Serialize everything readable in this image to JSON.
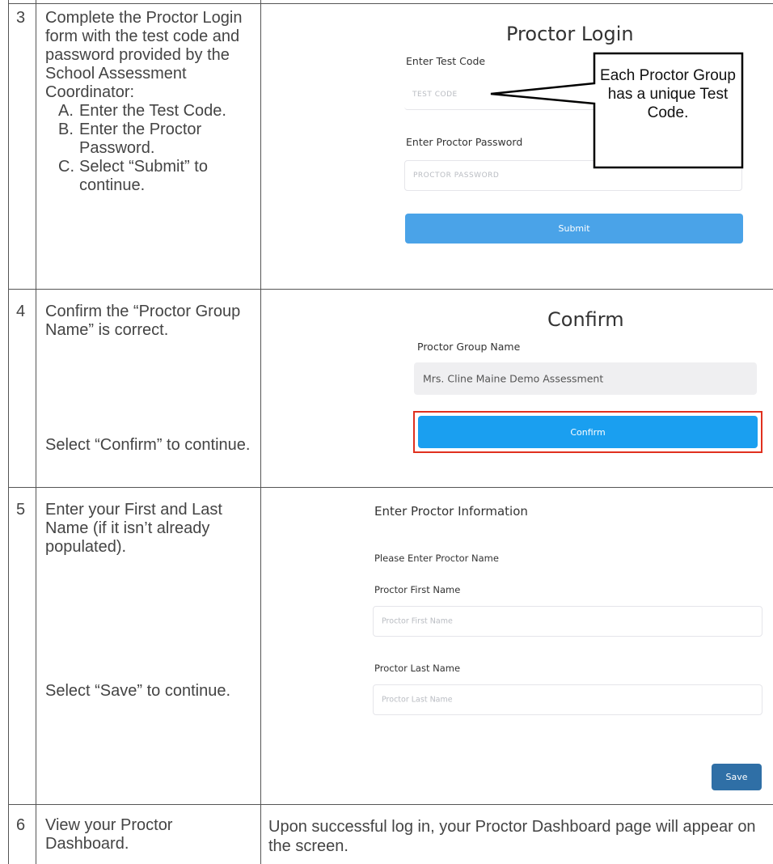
{
  "rows": [
    {
      "number": "3",
      "instruction": "Complete the Proctor Login form with the test code and password provided by the School Assessment Coordinator:",
      "substeps": [
        {
          "letter": "A.",
          "text": "Enter the Test Code."
        },
        {
          "letter": "B.",
          "text": "Enter the Proctor Password."
        },
        {
          "letter": "C.",
          "text": "Select “Submit” to continue."
        }
      ]
    },
    {
      "number": "4",
      "instruction": "Confirm the “Proctor Group Name” is correct.",
      "followup": "Select “Confirm” to continue."
    },
    {
      "number": "5",
      "instruction": "Enter your First and Last Name (if it isn’t already populated).",
      "followup": "Select “Save” to continue."
    },
    {
      "number": "6",
      "instruction": "View your Proctor Dashboard.",
      "result": "Upon successful log in, your Proctor Dashboard page will appear on the screen."
    }
  ],
  "proctor_login": {
    "title": "Proctor Login",
    "test_code_label": "Enter Test Code",
    "test_code_placeholder": "TEST CODE",
    "password_label": "Enter Proctor Password",
    "password_placeholder": "PROCTOR PASSWORD",
    "submit_label": "Submit",
    "callout": "Each Proctor Group has a unique Test Code."
  },
  "confirm": {
    "title": "Confirm",
    "group_label": "Proctor Group Name",
    "group_value": "Mrs. Cline Maine Demo Assessment",
    "confirm_label": "Confirm"
  },
  "proctor_info": {
    "title": "Enter Proctor Information",
    "subtitle": "Please Enter Proctor Name",
    "first_label": "Proctor First Name",
    "first_placeholder": "Proctor First Name",
    "last_label": "Proctor Last Name",
    "last_placeholder": "Proctor Last Name",
    "save_label": "Save"
  },
  "colors": {
    "submit_button": "#4aa3e8",
    "confirm_button": "#1a9ff0",
    "confirm_highlight": "#e0301e",
    "save_button": "#2f6fa6",
    "readonly_field": "#efeff1"
  }
}
